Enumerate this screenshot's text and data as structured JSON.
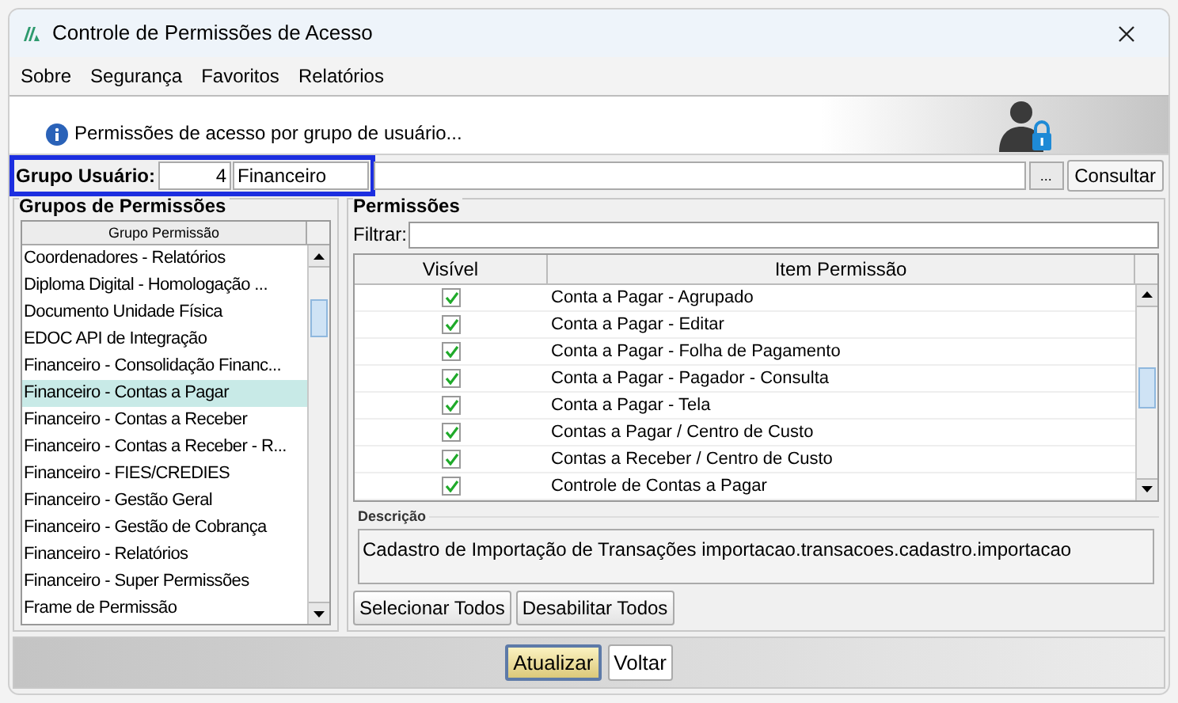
{
  "window": {
    "title": "Controle de Permissões de Acesso"
  },
  "menu": [
    "Sobre",
    "Segurança",
    "Favoritos",
    "Relatórios"
  ],
  "banner": {
    "text": "Permissões de acesso por grupo de usuário..."
  },
  "group_user": {
    "label": "Grupo Usuário:",
    "code": "4",
    "name": "Financeiro",
    "browse_button": "...",
    "query_button": "Consultar"
  },
  "groups_panel": {
    "title": "Grupos de Permissões",
    "column": "Grupo Permissão",
    "items": [
      {
        "label": "Coordenadores - Relatórios",
        "selected": false
      },
      {
        "label": "Diploma Digital - Homologação ...",
        "selected": false
      },
      {
        "label": "Documento Unidade Física",
        "selected": false
      },
      {
        "label": "EDOC API de Integração",
        "selected": false
      },
      {
        "label": "Financeiro - Consolidação Financ...",
        "selected": false
      },
      {
        "label": "Financeiro - Contas a Pagar",
        "selected": true
      },
      {
        "label": "Financeiro - Contas a Receber",
        "selected": false
      },
      {
        "label": "Financeiro - Contas a Receber - R...",
        "selected": false
      },
      {
        "label": "Financeiro - FIES/CREDIES",
        "selected": false
      },
      {
        "label": "Financeiro - Gestão Geral",
        "selected": false
      },
      {
        "label": "Financeiro - Gestão de Cobrança",
        "selected": false
      },
      {
        "label": "Financeiro - Relatórios",
        "selected": false
      },
      {
        "label": "Financeiro - Super Permissões",
        "selected": false
      },
      {
        "label": "Frame de Permissão",
        "selected": false
      }
    ]
  },
  "permissions_panel": {
    "title": "Permissões",
    "filter_label": "Filtrar:",
    "columns": [
      "Visível",
      "Item Permissão"
    ],
    "rows": [
      {
        "visible": true,
        "item": "Conta a Pagar - Agrupado"
      },
      {
        "visible": true,
        "item": "Conta a Pagar - Editar"
      },
      {
        "visible": true,
        "item": "Conta a Pagar - Folha de Pagamento"
      },
      {
        "visible": true,
        "item": "Conta a Pagar - Pagador - Consulta"
      },
      {
        "visible": true,
        "item": "Conta a Pagar - Tela"
      },
      {
        "visible": true,
        "item": "Contas a Pagar / Centro de Custo"
      },
      {
        "visible": true,
        "item": "Contas a Receber / Centro de Custo"
      },
      {
        "visible": true,
        "item": "Controle de Contas a Pagar"
      }
    ],
    "description_label": "Descrição",
    "description": "Cadastro de Importação de Transações importacao.transacoes.cadastro.importacao",
    "buttons": [
      "Selecionar Todos",
      "Desabilitar Todos"
    ]
  },
  "footer_buttons": [
    {
      "label": "Atualizar",
      "primary": true
    },
    {
      "label": "Voltar",
      "primary": false
    }
  ]
}
